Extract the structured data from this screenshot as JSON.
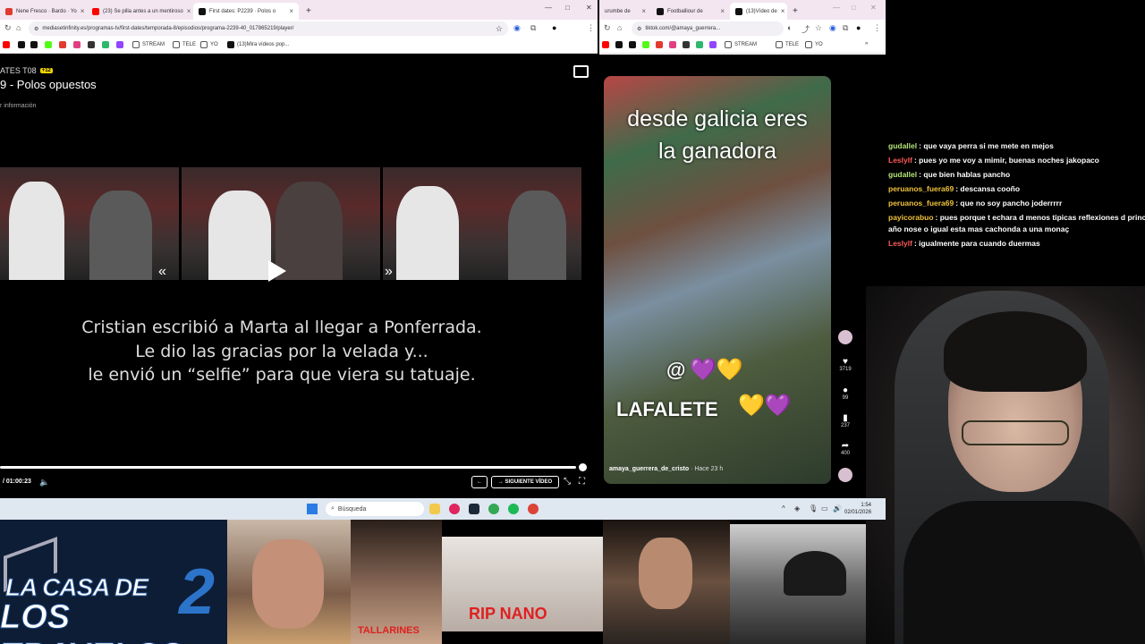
{
  "left_browser": {
    "tabs": [
      {
        "label": "Nene Fresco · Bardo · Yo",
        "color": "#e23a2f"
      },
      {
        "label": "(23) Se pilla antes a un mentiroso",
        "color": "#ff0000"
      },
      {
        "label": "First dates: P2239 · Polos o",
        "color": "#111111"
      }
    ],
    "url": "mediasetinfinity.es/programas-tv/first-dates/temporada-8/episodios/programa-2239-40_017865219/player/",
    "bookmarks": [
      "STREAM",
      "TELE",
      "YO",
      "(13)Mira vídeos pop..."
    ]
  },
  "player": {
    "show_title": "ATES T08",
    "age_badge": "+12",
    "episode_title": "9 - Polos opuestos",
    "more_info": "r información",
    "subtitle_lines": [
      "Cristian escribió a Marta al llegar a Ponferrada.",
      "Le dio las gracias por la velada y...",
      "le envió un “selfie” para que viera su tatuaje."
    ],
    "time": "/ 01:00:23",
    "next_label": "SIGUIENTE VÍDEO",
    "progress": 0.99
  },
  "right_browser": {
    "tabs": [
      {
        "label": "urumbe de",
        "color": "#e23a2f"
      },
      {
        "label": "Footballiour de",
        "color": "#111111"
      },
      {
        "label": "(13)Vídeo de",
        "color": "#111111"
      }
    ],
    "url": "tiktok.com/@amaya_guerrera...",
    "bookmarks": [
      "STREAM",
      "TELE",
      "YO"
    ]
  },
  "tiktok": {
    "caption_lines": [
      "desde galicia eres",
      "la ganadora"
    ],
    "mention": "@",
    "tag": "LAFALETE",
    "hearts_1": "💜💛",
    "hearts_2": "💛💜",
    "username": "amaya_guerrera_de_cristo",
    "posted": "· Hace 23 h",
    "stats": {
      "likes": "3719",
      "comments": "99",
      "saves": "237",
      "shares": "400"
    }
  },
  "chat": [
    {
      "user": "gudallel",
      "color": "#b5e37a",
      "text": ": que vaya perra si me mete en mejos"
    },
    {
      "user": "Leslylf",
      "color": "#ff5a5a",
      "text": ": pues yo me voy a mimir, buenas noches jakopaco"
    },
    {
      "user": "gudallel",
      "color": "#b5e37a",
      "text": ": que bien hablas pancho"
    },
    {
      "user": "peruanos_fuera69",
      "color": "#f0c23a",
      "text": ": descansa cooño"
    },
    {
      "user": "peruanos_fuera69",
      "color": "#f0c23a",
      "text": ": que no soy pancho joderrrrr"
    },
    {
      "user": "payicorabuo",
      "color": "#f0c23a",
      "text": ": pues porque t echara d menos tipicas reflexiones d princ"
    },
    {
      "user": "",
      "color": "#ffffff",
      "text": "año nose o igual esta mas cachonda a una monaç"
    },
    {
      "user": "Leslylf",
      "color": "#ff5a5a",
      "text": ": igualmente para cuando duermas"
    }
  ],
  "taskbar": {
    "search_placeholder": "Búsqueda",
    "time": "1:54",
    "date": "02/01/2026"
  },
  "overlays": {
    "logo_line1": "LA CASA DE",
    "logo_line2": "LOS TRAVELOS",
    "logo_number": "2",
    "tallarines": "TALLARINES",
    "rip": "RIP NANO"
  }
}
